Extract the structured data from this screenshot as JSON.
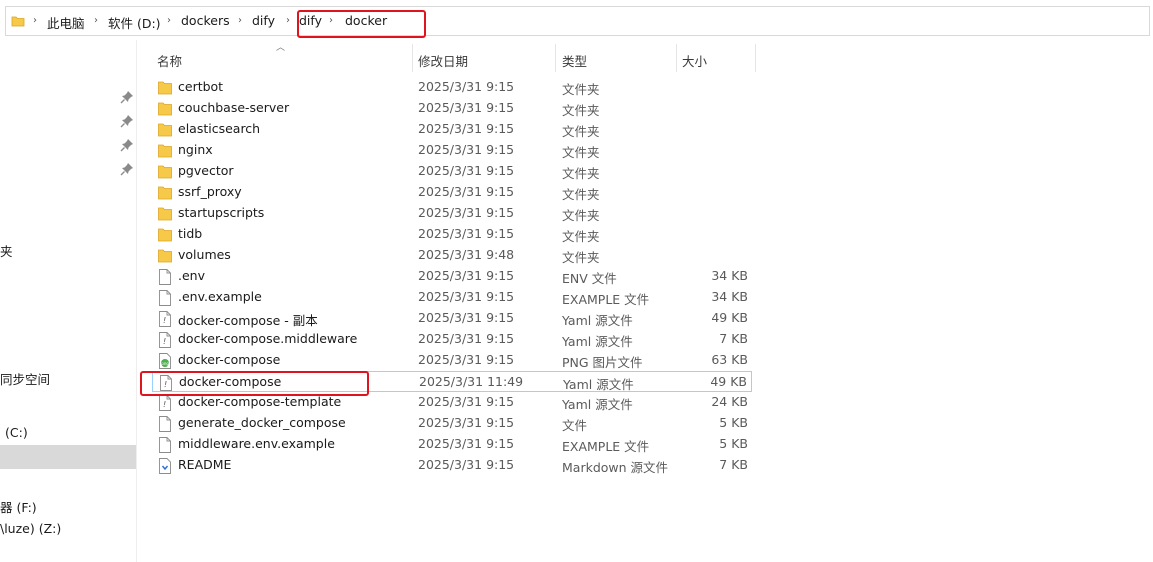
{
  "breadcrumb": {
    "items": [
      "此电脑",
      "软件 (D:)",
      "dockers",
      "dify",
      "dify",
      "docker"
    ]
  },
  "sidebar": {
    "items": [
      "夹",
      "同步空间",
      "(C:)",
      "器 (F:)",
      "\\luze) (Z:)"
    ]
  },
  "columns": {
    "name": "名称",
    "date": "修改日期",
    "type": "类型",
    "size": "大小"
  },
  "files": [
    {
      "name": "certbot",
      "date": "2025/3/31 9:15",
      "type": "文件夹",
      "size": "",
      "icon": "folder"
    },
    {
      "name": "couchbase-server",
      "date": "2025/3/31 9:15",
      "type": "文件夹",
      "size": "",
      "icon": "folder"
    },
    {
      "name": "elasticsearch",
      "date": "2025/3/31 9:15",
      "type": "文件夹",
      "size": "",
      "icon": "folder"
    },
    {
      "name": "nginx",
      "date": "2025/3/31 9:15",
      "type": "文件夹",
      "size": "",
      "icon": "folder"
    },
    {
      "name": "pgvector",
      "date": "2025/3/31 9:15",
      "type": "文件夹",
      "size": "",
      "icon": "folder"
    },
    {
      "name": "ssrf_proxy",
      "date": "2025/3/31 9:15",
      "type": "文件夹",
      "size": "",
      "icon": "folder"
    },
    {
      "name": "startupscripts",
      "date": "2025/3/31 9:15",
      "type": "文件夹",
      "size": "",
      "icon": "folder"
    },
    {
      "name": "tidb",
      "date": "2025/3/31 9:15",
      "type": "文件夹",
      "size": "",
      "icon": "folder"
    },
    {
      "name": "volumes",
      "date": "2025/3/31 9:48",
      "type": "文件夹",
      "size": "",
      "icon": "folder"
    },
    {
      "name": ".env",
      "date": "2025/3/31 9:15",
      "type": "ENV 文件",
      "size": "34 KB",
      "icon": "file"
    },
    {
      "name": ".env.example",
      "date": "2025/3/31 9:15",
      "type": "EXAMPLE 文件",
      "size": "34 KB",
      "icon": "file"
    },
    {
      "name": "docker-compose - 副本",
      "date": "2025/3/31 9:15",
      "type": "Yaml 源文件",
      "size": "49 KB",
      "icon": "yaml"
    },
    {
      "name": "docker-compose.middleware",
      "date": "2025/3/31 9:15",
      "type": "Yaml 源文件",
      "size": "7 KB",
      "icon": "yaml"
    },
    {
      "name": "docker-compose",
      "date": "2025/3/31 9:15",
      "type": "PNG 图片文件",
      "size": "63 KB",
      "icon": "png"
    },
    {
      "name": "docker-compose",
      "date": "2025/3/31 11:49",
      "type": "Yaml 源文件",
      "size": "49 KB",
      "icon": "yaml"
    },
    {
      "name": "docker-compose-template",
      "date": "2025/3/31 9:15",
      "type": "Yaml 源文件",
      "size": "24 KB",
      "icon": "yaml"
    },
    {
      "name": "generate_docker_compose",
      "date": "2025/3/31 9:15",
      "type": "文件",
      "size": "5 KB",
      "icon": "file"
    },
    {
      "name": "middleware.env.example",
      "date": "2025/3/31 9:15",
      "type": "EXAMPLE 文件",
      "size": "5 KB",
      "icon": "file"
    },
    {
      "name": "README",
      "date": "2025/3/31 9:15",
      "type": "Markdown 源文件",
      "size": "7 KB",
      "icon": "markdown"
    }
  ],
  "colors": {
    "highlight": "#e0141e",
    "folder": "#f7c948",
    "selection": "#99d1ff"
  }
}
